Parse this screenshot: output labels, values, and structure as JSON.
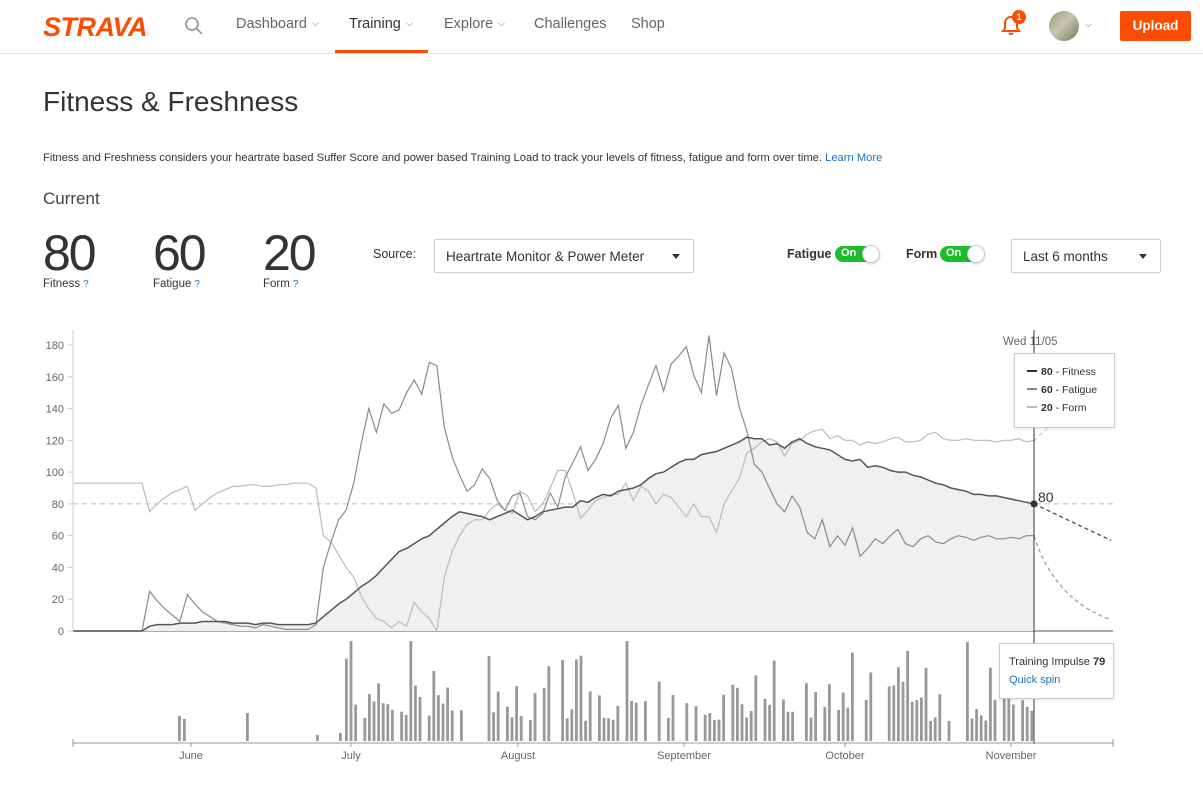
{
  "nav": {
    "logo": "STRAVA",
    "items": [
      {
        "label": "Dashboard",
        "has_menu": true
      },
      {
        "label": "Training",
        "has_menu": true,
        "active": true
      },
      {
        "label": "Explore",
        "has_menu": true
      },
      {
        "label": "Challenges",
        "has_menu": false
      },
      {
        "label": "Shop",
        "has_menu": false
      }
    ],
    "notification_count": "1",
    "upload_label": "Upload",
    "brand_color": "#fc4c02"
  },
  "page": {
    "title": "Fitness & Freshness",
    "description": "Fitness and Freshness considers your heartrate based Suffer Score and power based Training Load to track your levels of fitness, fatigue and form over time.",
    "learn_more": "Learn More",
    "current_label": "Current"
  },
  "stats": [
    {
      "value": "80",
      "label": "Fitness",
      "help": "?"
    },
    {
      "value": "60",
      "label": "Fatigue",
      "help": "?"
    },
    {
      "value": "20",
      "label": "Form",
      "help": "?"
    }
  ],
  "controls": {
    "source_label": "Source:",
    "source_value": "Heartrate Monitor & Power Meter",
    "fatigue_label": "Fatigue",
    "fatigue_toggle": "On",
    "form_label": "Form",
    "form_toggle": "On",
    "range_value": "Last 6 months",
    "toggle_color": "#1bbd2a"
  },
  "tooltip": {
    "date": "Wed 11/05",
    "fitness_value": "80",
    "fitness_label": " - Fitness",
    "fatigue_value": "60",
    "fatigue_label": " - Fatigue",
    "form_value": "20",
    "form_label": " - Form",
    "marker_value": "80",
    "impulse_label": "Training Impulse",
    "impulse_value": "79",
    "activity_link": "Quick spin"
  },
  "chart_data": {
    "type": "line",
    "y_ticks": [
      0,
      20,
      40,
      60,
      80,
      100,
      120,
      140,
      160,
      180
    ],
    "ylim": [
      0,
      190
    ],
    "months": [
      "June",
      "July",
      "August",
      "September",
      "October",
      "November"
    ],
    "reference_line": 80,
    "series": [
      {
        "name": "Fitness",
        "color": "#555555",
        "values": [
          0,
          0,
          0,
          0,
          0,
          0,
          0,
          0,
          0,
          0,
          3,
          4,
          4,
          4,
          5,
          5,
          5,
          6,
          6,
          6,
          6,
          5,
          5,
          5,
          4,
          5,
          5,
          4,
          4,
          4,
          4,
          4,
          5,
          9,
          13,
          17,
          20,
          24,
          28,
          31,
          35,
          40,
          45,
          50,
          52,
          55,
          58,
          60,
          64,
          68,
          72,
          75,
          74,
          73,
          72,
          70,
          72,
          74,
          76,
          73,
          70,
          72,
          75,
          76,
          77,
          78,
          78,
          82,
          81,
          84,
          86,
          85,
          88,
          89,
          90,
          92,
          96,
          99,
          100,
          103,
          106,
          108,
          108,
          111,
          112,
          113,
          115,
          117,
          119,
          122,
          121,
          121,
          117,
          118,
          115,
          119,
          121,
          118,
          116,
          115,
          114,
          111,
          108,
          107,
          108,
          103,
          104,
          103,
          101,
          100,
          100,
          98,
          97,
          95,
          93,
          92,
          90,
          89,
          88,
          86,
          86,
          85,
          85,
          84,
          83,
          82,
          81,
          80
        ]
      },
      {
        "name": "Fatigue",
        "color": "#8a8a8a",
        "values": [
          0,
          0,
          0,
          0,
          0,
          0,
          0,
          0,
          0,
          0,
          25,
          19,
          14,
          10,
          6,
          23,
          17,
          12,
          9,
          6,
          5,
          4,
          3,
          3,
          2,
          4,
          3,
          2,
          1,
          1,
          1,
          1,
          4,
          40,
          56,
          70,
          76,
          93,
          118,
          140,
          125,
          143,
          137,
          139,
          150,
          158,
          149,
          169,
          167,
          128,
          110,
          98,
          88,
          92,
          102,
          96,
          82,
          76,
          85,
          87,
          72,
          70,
          74,
          87,
          78,
          97,
          106,
          116,
          101,
          108,
          118,
          134,
          142,
          115,
          125,
          142,
          155,
          167,
          151,
          168,
          173,
          179,
          161,
          150,
          186,
          148,
          175,
          165,
          141,
          126,
          105,
          100,
          90,
          80,
          75,
          85,
          78,
          62,
          58,
          70,
          53,
          60,
          54,
          65,
          47,
          52,
          58,
          55,
          60,
          64,
          55,
          53,
          58,
          60,
          56,
          55,
          58,
          60,
          59,
          57,
          59,
          60,
          58,
          58,
          59,
          58,
          60,
          60
        ]
      },
      {
        "name": "Form",
        "color": "#bbbbbb",
        "values": [
          93,
          93,
          93,
          93,
          93,
          93,
          93,
          93,
          93,
          93,
          75,
          80,
          84,
          87,
          89,
          91,
          76,
          80,
          84,
          87,
          89,
          91,
          91,
          92,
          92,
          91,
          91,
          92,
          92,
          93,
          93,
          93,
          90,
          60,
          56,
          48,
          40,
          34,
          22,
          14,
          8,
          6,
          2,
          6,
          3,
          18,
          12,
          8,
          -1,
          34,
          50,
          60,
          67,
          70,
          70,
          76,
          80,
          76,
          74,
          88,
          85,
          75,
          80,
          90,
          101,
          101,
          87,
          71,
          76,
          82,
          84,
          86,
          86,
          93,
          82,
          91,
          88,
          80,
          86,
          84,
          78,
          72,
          80,
          72,
          72,
          62,
          80,
          88,
          96,
          112,
          115,
          119,
          121,
          119,
          110,
          118,
          120,
          124,
          126,
          127,
          121,
          123,
          120,
          120,
          117,
          119,
          118,
          119,
          121,
          122,
          119,
          119,
          120,
          124,
          125,
          121,
          120,
          120,
          121,
          120,
          120,
          120,
          119,
          120,
          120,
          121,
          119,
          120
        ]
      }
    ],
    "projection": {
      "fitness_to": 57,
      "fatigue_to": 7,
      "form_to": 130
    },
    "training_impulse_label": "Training Impulse"
  }
}
